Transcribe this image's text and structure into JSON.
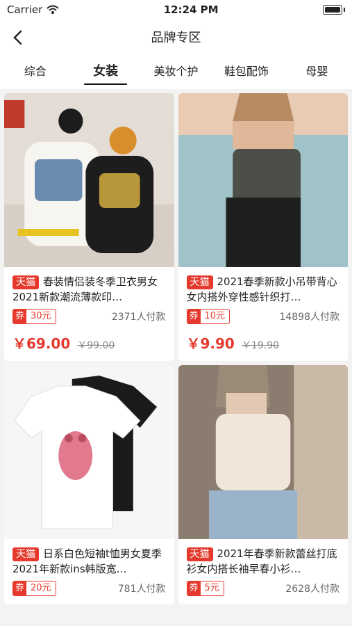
{
  "status": {
    "carrier": "Carrier",
    "time": "12:24 PM"
  },
  "nav": {
    "title": "品牌专区"
  },
  "tabs": [
    "综合",
    "女装",
    "美妆个护",
    "鞋包配饰",
    "母婴"
  ],
  "products": [
    {
      "tag": "天猫",
      "name": "春装情侣装冬季卫衣男女2021新款潮流薄款印…",
      "coupon_prefix": "券",
      "coupon_value": "30元",
      "sold": "2371人付款",
      "price": "￥69.00",
      "old_price": "￥99.00"
    },
    {
      "tag": "天猫",
      "name": "2021春季新款小吊带背心女内搭外穿性感针织打…",
      "coupon_prefix": "券",
      "coupon_value": "10元",
      "sold": "14898人付款",
      "price": "￥9.90",
      "old_price": "￥19.90"
    },
    {
      "tag": "天猫",
      "name": "日系白色短袖t恤男女夏季2021年新款ins韩版宽…",
      "coupon_prefix": "券",
      "coupon_value": "20元",
      "sold": "781人付款"
    },
    {
      "tag": "天猫",
      "name": "2021年春季新款蕾丝打底衫女内搭长袖早春小衫…",
      "coupon_prefix": "券",
      "coupon_value": "5元",
      "sold": "2628人付款"
    }
  ],
  "colors": {
    "accent": "#e4392c"
  }
}
